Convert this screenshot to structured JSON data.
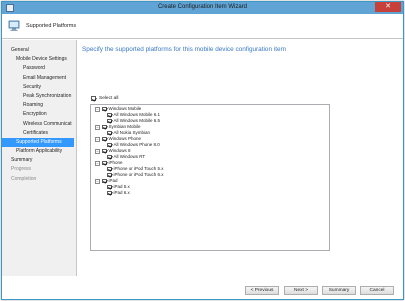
{
  "window": {
    "title": "Create Configuration Item Wizard",
    "close_glyph": "✕"
  },
  "header": {
    "title": "Supported Platforms",
    "icon": "computer-icon"
  },
  "nav": {
    "items": [
      {
        "label": "General",
        "level": 1,
        "active": false,
        "disabled": false
      },
      {
        "label": "Mobile Device Settings",
        "level": 2,
        "active": false,
        "disabled": false
      },
      {
        "label": "Password",
        "level": 3,
        "active": false,
        "disabled": false
      },
      {
        "label": "Email Management",
        "level": 3,
        "active": false,
        "disabled": false
      },
      {
        "label": "Security",
        "level": 3,
        "active": false,
        "disabled": false
      },
      {
        "label": "Peak Synchronization",
        "level": 3,
        "active": false,
        "disabled": false
      },
      {
        "label": "Roaming",
        "level": 3,
        "active": false,
        "disabled": false
      },
      {
        "label": "Encryption",
        "level": 3,
        "active": false,
        "disabled": false
      },
      {
        "label": "Wireless Communicat",
        "level": 3,
        "active": false,
        "disabled": false
      },
      {
        "label": "Certificates",
        "level": 3,
        "active": false,
        "disabled": false
      },
      {
        "label": "Supported Platforms",
        "level": 2,
        "active": true,
        "disabled": false
      },
      {
        "label": "Platform Applicability",
        "level": 2,
        "active": false,
        "disabled": false
      },
      {
        "label": "Summary",
        "level": 1,
        "active": false,
        "disabled": false
      },
      {
        "label": "Progress",
        "level": 1,
        "active": false,
        "disabled": true
      },
      {
        "label": "Completion",
        "level": 1,
        "active": false,
        "disabled": true
      }
    ]
  },
  "content": {
    "heading": "Specify the supported platforms for this mobile device configuration item",
    "select_all": {
      "label": "Select all",
      "checked": true
    }
  },
  "tree": {
    "expander_glyph": "−",
    "platforms": [
      {
        "label": "Windows Mobile",
        "checked": true,
        "children": [
          {
            "label": "All Windows Mobile 6.1",
            "checked": true
          },
          {
            "label": "All Windows Mobile 6.5",
            "checked": true
          }
        ]
      },
      {
        "label": "Symbian Mobile",
        "checked": true,
        "children": [
          {
            "label": "All Nokia Symbian",
            "checked": true
          }
        ]
      },
      {
        "label": "Windows Phone",
        "checked": true,
        "children": [
          {
            "label": "All Windows Phone 8.0",
            "checked": true
          }
        ]
      },
      {
        "label": "Windows 8",
        "checked": true,
        "children": [
          {
            "label": "All Windows RT",
            "checked": true
          }
        ]
      },
      {
        "label": "iPhone",
        "checked": true,
        "children": [
          {
            "label": "iPhone or iPod Touch 5.x",
            "checked": true
          },
          {
            "label": "iPhone or iPod Touch 6.x",
            "checked": true
          }
        ]
      },
      {
        "label": "iPad",
        "checked": true,
        "children": [
          {
            "label": "iPad 5.x",
            "checked": true
          },
          {
            "label": "iPad 6.x",
            "checked": true
          }
        ]
      }
    ]
  },
  "footer": {
    "previous_label": "< Previous",
    "next_label": "Next >",
    "summary_label": "Summary",
    "cancel_label": "Cancel"
  },
  "colors": {
    "titlebar": "#5fa4d4",
    "accent": "#3399ff",
    "heading_text": "#3a78c4",
    "close_button": "#c7403a"
  }
}
